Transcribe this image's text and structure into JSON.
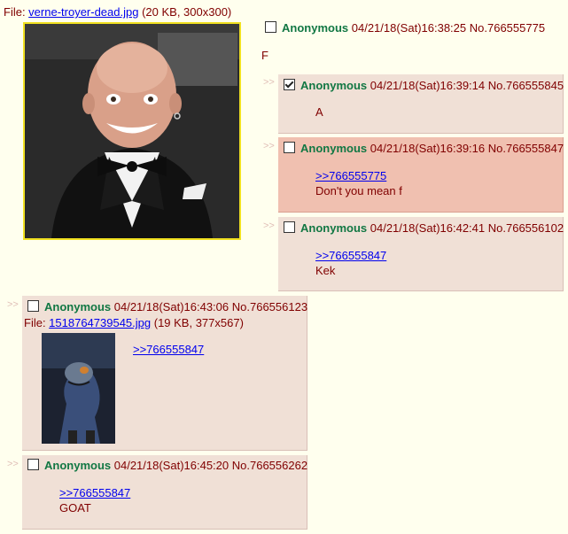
{
  "op": {
    "file_prefix": "File: ",
    "file_name": "verne-troyer-dead.jpg",
    "file_meta": " (20 KB, 300x300)",
    "name": "Anonymous",
    "datetime": "04/21/18(Sat)16:38:25",
    "no": "No.766555775",
    "text": "F"
  },
  "arrows": ">>",
  "replies": [
    {
      "name": "Anonymous",
      "datetime": "04/21/18(Sat)16:39:14",
      "no": "No.766555845",
      "quote": "",
      "text": "A"
    },
    {
      "name": "Anonymous",
      "datetime": "04/21/18(Sat)16:39:16",
      "no": "No.766555847",
      "quote": ">>766555775",
      "text": "Don't you mean f"
    },
    {
      "name": "Anonymous",
      "datetime": "04/21/18(Sat)16:42:41",
      "no": "No.766556102",
      "quote": ">>766555847",
      "text": "Kek"
    },
    {
      "name": "Anonymous",
      "datetime": "04/21/18(Sat)16:43:06",
      "no": "No.766556123",
      "file_prefix": "File: ",
      "file_name": "1518764739545.jpg",
      "file_meta": " (19 KB, 377x567)",
      "quote": ">>766555847",
      "text": ""
    },
    {
      "name": "Anonymous",
      "datetime": "04/21/18(Sat)16:45:20",
      "no": "No.766556262",
      "quote": ">>766555847",
      "text": "GOAT"
    }
  ]
}
